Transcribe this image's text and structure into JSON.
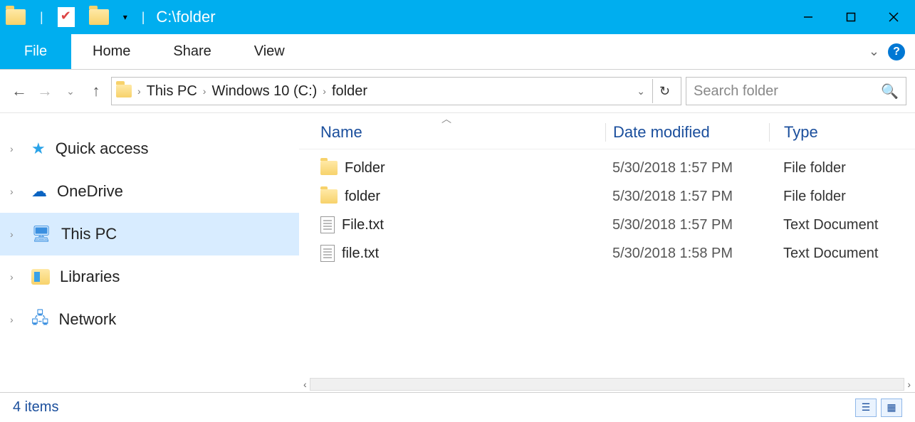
{
  "title_path": "C:\\folder",
  "ribbon": {
    "file": "File",
    "tabs": [
      "Home",
      "Share",
      "View"
    ]
  },
  "breadcrumb": [
    "This PC",
    "Windows 10 (C:)",
    "folder"
  ],
  "search": {
    "placeholder": "Search folder"
  },
  "nav_pane": [
    {
      "label": "Quick access",
      "icon": "star"
    },
    {
      "label": "OneDrive",
      "icon": "cloud"
    },
    {
      "label": "This PC",
      "icon": "pc",
      "selected": true
    },
    {
      "label": "Libraries",
      "icon": "lib"
    },
    {
      "label": "Network",
      "icon": "net"
    }
  ],
  "columns": {
    "name": "Name",
    "date": "Date modified",
    "type": "Type"
  },
  "items": [
    {
      "name": "Folder",
      "date": "5/30/2018 1:57 PM",
      "type": "File folder",
      "icon": "folder"
    },
    {
      "name": "folder",
      "date": "5/30/2018 1:57 PM",
      "type": "File folder",
      "icon": "folder"
    },
    {
      "name": "File.txt",
      "date": "5/30/2018 1:57 PM",
      "type": "Text Document",
      "icon": "file"
    },
    {
      "name": "file.txt",
      "date": "5/30/2018 1:58 PM",
      "type": "Text Document",
      "icon": "file"
    }
  ],
  "status": {
    "count_label": "4 items"
  }
}
